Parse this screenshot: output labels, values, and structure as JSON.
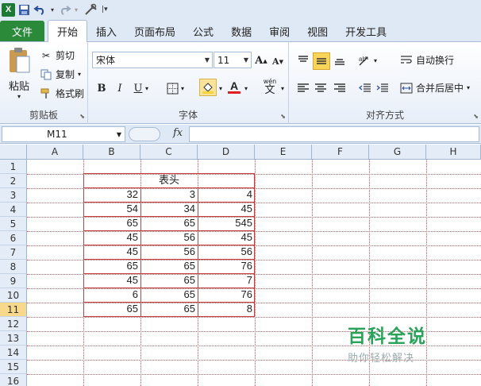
{
  "qat": {
    "undo_icon": "undo-icon",
    "redo_icon": "redo-icon"
  },
  "tabs": [
    "文件",
    "开始",
    "插入",
    "页面布局",
    "公式",
    "数据",
    "审阅",
    "视图",
    "开发工具"
  ],
  "ribbon": {
    "clipboard": {
      "paste": "粘贴",
      "cut": "剪切",
      "copy": "复制",
      "format_painter": "格式刷",
      "label": "剪贴板"
    },
    "font": {
      "name": "宋体",
      "size": "11",
      "bold": "B",
      "italic": "I",
      "underline": "U",
      "label": "字体",
      "wen": "wén",
      "wen_char": "文"
    },
    "align": {
      "wrap": "自动换行",
      "merge": "合并后居中",
      "label": "对齐方式"
    }
  },
  "formula_bar": {
    "name_box": "M11",
    "fx": "fx",
    "formula": ""
  },
  "columns": [
    "A",
    "B",
    "C",
    "D",
    "E",
    "F",
    "G",
    "H"
  ],
  "rows": [
    "1",
    "2",
    "3",
    "4",
    "5",
    "6",
    "7",
    "8",
    "9",
    "10",
    "11",
    "12",
    "13",
    "14",
    "15",
    "16"
  ],
  "selected_row": "11",
  "table": {
    "header": "表头",
    "data": [
      [
        "32",
        "3",
        "4"
      ],
      [
        "54",
        "34",
        "45"
      ],
      [
        "65",
        "65",
        "545"
      ],
      [
        "45",
        "56",
        "45"
      ],
      [
        "45",
        "56",
        "56"
      ],
      [
        "65",
        "65",
        "76"
      ],
      [
        "45",
        "65",
        "7"
      ],
      [
        "6",
        "65",
        "76"
      ],
      [
        "65",
        "65",
        "8"
      ]
    ]
  },
  "watermark": {
    "title": "百科全说",
    "subtitle": "助你轻松解决"
  },
  "colors": {
    "file_tab": "#2a8a3a",
    "gridline": "#e25555",
    "table_border": "#cf3a3a",
    "fill_highlight": "#f5d53a",
    "font_color": "#e02020"
  }
}
